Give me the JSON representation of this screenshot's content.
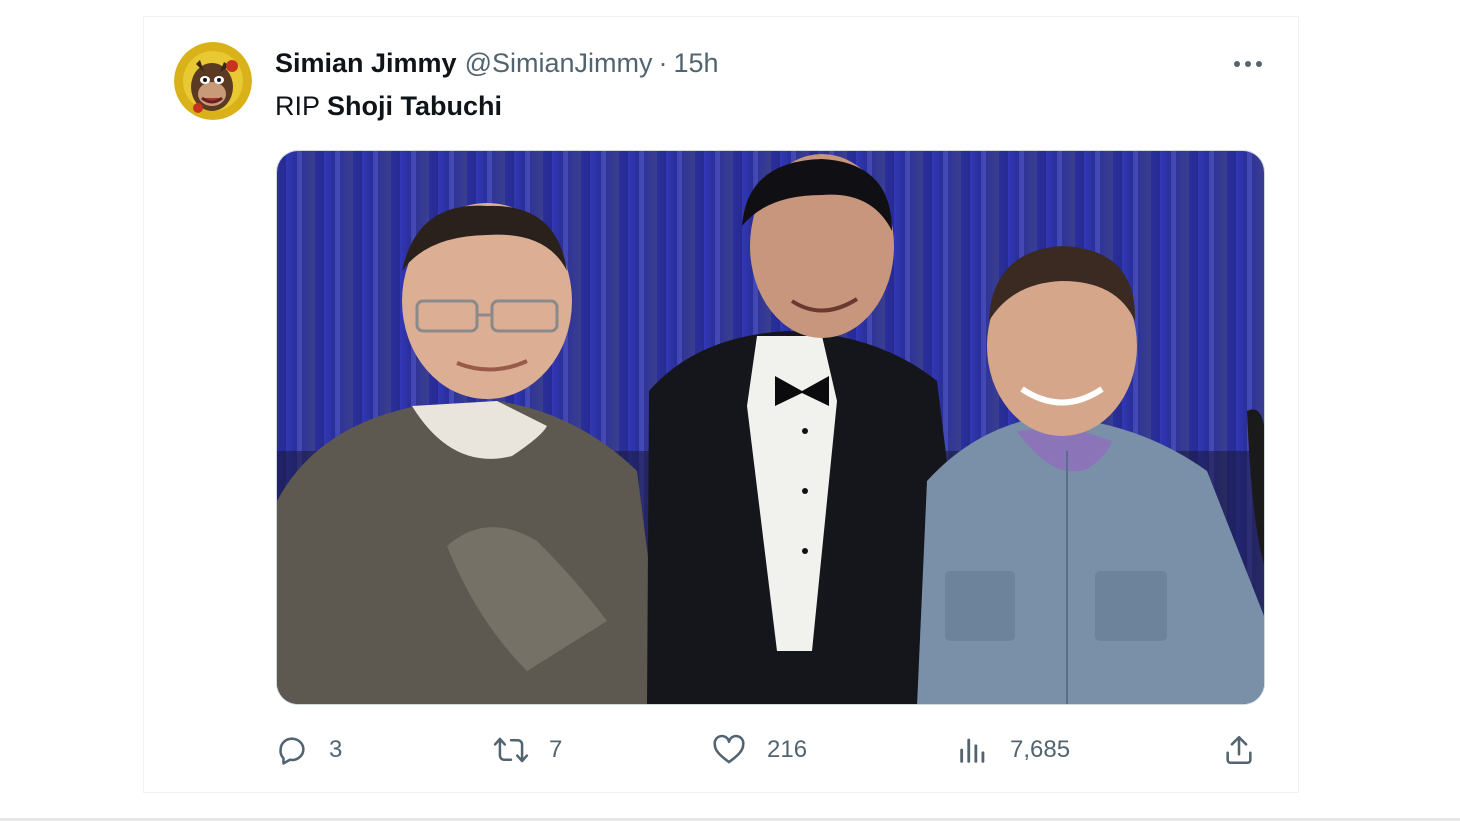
{
  "tweet": {
    "display_name": "Simian Jimmy",
    "handle": "@SimianJimmy",
    "separator": "·",
    "timestamp": "15h",
    "text_prefix": "RIP ",
    "text_bold": "Shoji Tabuchi",
    "avatar_icon": "monkey-avatar-icon",
    "more_icon": "more-options-icon"
  },
  "media": {
    "subject": "photo of three men posing in front of a blue stage curtain"
  },
  "actions": {
    "reply": {
      "icon": "reply-icon",
      "count": "3"
    },
    "retweet": {
      "icon": "retweet-icon",
      "count": "7"
    },
    "like": {
      "icon": "heart-icon",
      "count": "216"
    },
    "views": {
      "icon": "analytics-icon",
      "count": "7,685"
    },
    "share": {
      "icon": "share-icon"
    }
  },
  "colors": {
    "text_primary": "#0f1419",
    "text_secondary": "#536471",
    "border": "#eff3f4",
    "curtain": "#2c2fa8"
  }
}
